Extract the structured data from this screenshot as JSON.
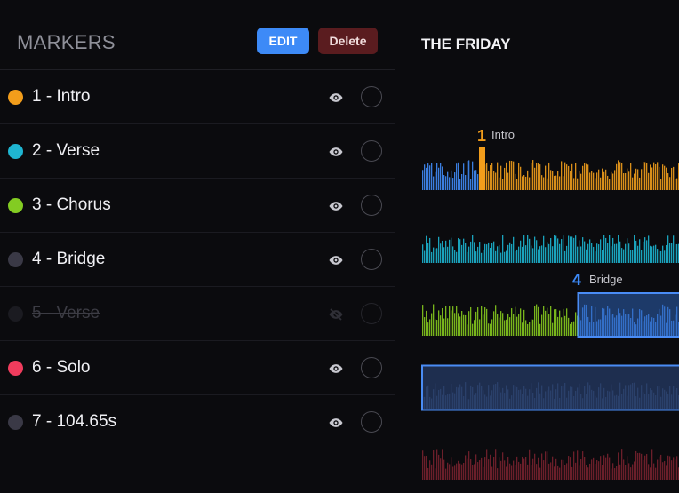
{
  "panel": {
    "title": "MARKERS",
    "edit_label": "EDIT",
    "delete_label": "Delete"
  },
  "markers": [
    {
      "label": "1 - Intro",
      "color": "#f29d1b",
      "visible": true
    },
    {
      "label": "2 - Verse",
      "color": "#1fb6d2",
      "visible": true
    },
    {
      "label": "3 - Chorus",
      "color": "#83cc22",
      "visible": true
    },
    {
      "label": "4 - Bridge",
      "color": "#3a3946",
      "visible": true
    },
    {
      "label": "5 - Verse",
      "color": "#1b1b21",
      "visible": false
    },
    {
      "label": "6 - Solo",
      "color": "#f03c5d",
      "visible": true
    },
    {
      "label": "7 - 104.65s",
      "color": "#3a3946",
      "visible": true
    }
  ],
  "song": {
    "title": "THE FRIDAY"
  },
  "waveform_markers": [
    {
      "number": "1",
      "name": "Intro",
      "color": "#f29d1b"
    },
    {
      "number": "4",
      "name": "Bridge",
      "color": "#3d8af7"
    }
  ],
  "colors": {
    "intro": "#d98f1a",
    "verse": "#1aa3bc",
    "chorus": "#78b51c",
    "bridge": "#3b7ee0",
    "solo": "#6b1f2a"
  }
}
